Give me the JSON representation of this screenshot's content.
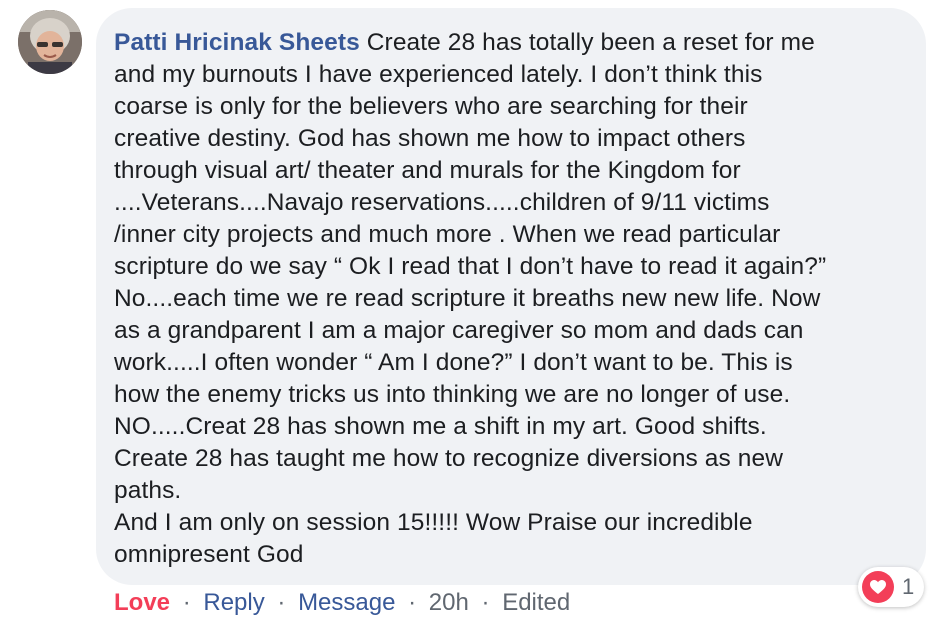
{
  "comment": {
    "author": "Patti Hricinak Sheets",
    "lines": [
      "Create 28 has totally been a reset for me",
      "and my burnouts I have experienced lately. I don’t think this",
      "coarse is only for the believers who are searching for their",
      "creative destiny. God has shown me how to impact others",
      "through visual art/ theater and murals for the Kingdom for",
      "....Veterans....Navajo reservations.....children of 9/11 victims",
      "/inner city projects and much more . When we read particular",
      "scripture do we say “ Ok I read that I don’t have to read it again?”",
      "No....each time we re read scripture it breaths new new life. Now",
      "as a grandparent I am a major caregiver so mom and dads can",
      "work.....I often wonder “ Am I done?” I don’t want to be. This is",
      "how the enemy tricks us into thinking we are no longer of use.",
      "NO.....Creat 28 has shown me a shift in my art. Good shifts.",
      "Create 28 has taught me how to recognize diversions as new",
      "paths.",
      "And I am only on session 15!!!!! Wow Praise our incredible",
      "omnipresent God"
    ]
  },
  "reaction": {
    "icon": "heart-icon",
    "count": "1",
    "color": "#f33e58"
  },
  "actions": {
    "love": "Love",
    "reply": "Reply",
    "message": "Message",
    "time": "20h",
    "edited": "Edited",
    "separator": "·"
  },
  "colors": {
    "author": "#385898",
    "bubble": "#f0f2f5",
    "text": "#1c1e21",
    "love": "#f33e58",
    "meta": "#606770"
  }
}
